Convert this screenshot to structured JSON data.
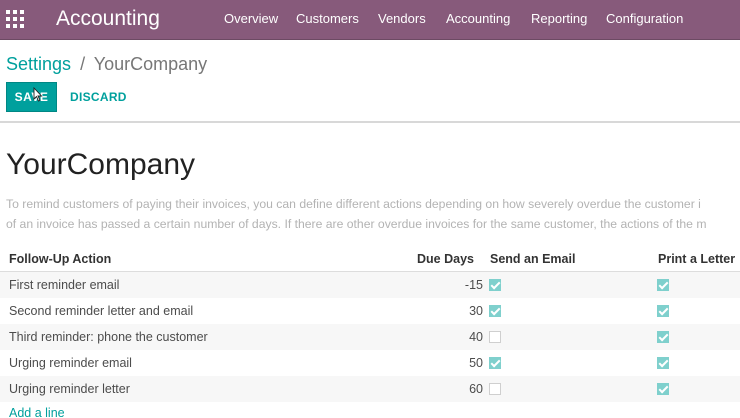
{
  "app": {
    "title": "Accounting"
  },
  "menu": [
    "Overview",
    "Customers",
    "Vendors",
    "Accounting",
    "Reporting",
    "Configuration"
  ],
  "breadcrumb": {
    "parent": "Settings",
    "separator": "/",
    "current": "YourCompany"
  },
  "buttons": {
    "save": "SAVE",
    "discard": "DISCARD"
  },
  "form": {
    "heading": "YourCompany",
    "help_line1": "To remind customers of paying their invoices, you can define different actions depending on how severely overdue the customer i",
    "help_line2": "of an invoice has passed a certain number of days. If there are other overdue invoices for the same customer, the actions of the m"
  },
  "table": {
    "columns": [
      "Follow-Up Action",
      "Due Days",
      "Send an Email",
      "Print a Letter"
    ],
    "rows": [
      {
        "action": "First reminder email",
        "due_days": "-15",
        "send_email": true,
        "print_letter": true
      },
      {
        "action": "Second reminder letter and email",
        "due_days": "30",
        "send_email": true,
        "print_letter": true
      },
      {
        "action": "Third reminder: phone the customer",
        "due_days": "40",
        "send_email": false,
        "print_letter": true
      },
      {
        "action": "Urging reminder email",
        "due_days": "50",
        "send_email": true,
        "print_letter": true
      },
      {
        "action": "Urging reminder letter",
        "due_days": "60",
        "send_email": false,
        "print_letter": true
      }
    ],
    "add_line": "Add a line"
  },
  "colors": {
    "navbar": "#875a7b",
    "primary": "#00a09d",
    "checkbox_checked": "#7fd0cd"
  },
  "icons": {
    "apps": "grid-apps-icon",
    "cursor": "mouse-pointer-icon",
    "checkbox": "checkbox-icon"
  }
}
